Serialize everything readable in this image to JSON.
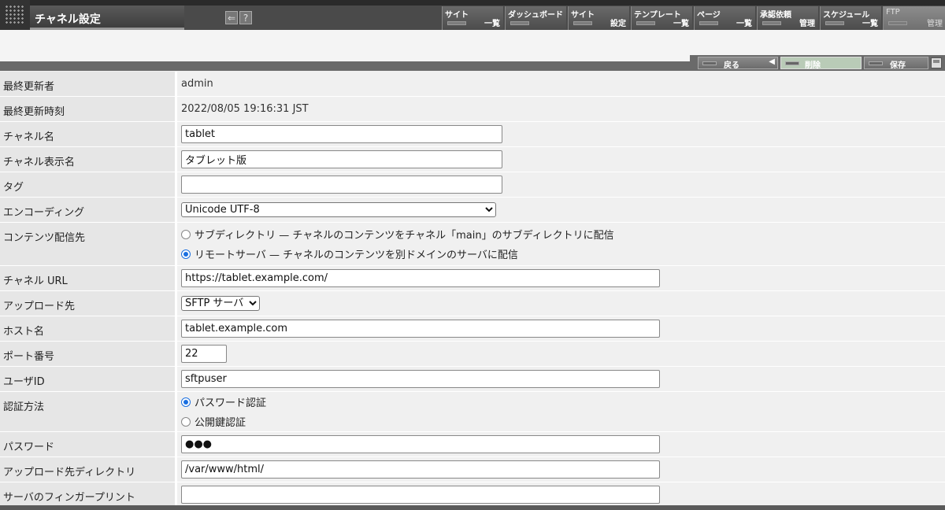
{
  "header": {
    "title": "チャネル設定",
    "tool_icons": [
      "back-arrow-icon",
      "help-icon"
    ],
    "help_glyph": "?",
    "nav": [
      {
        "top": "サイト",
        "bottom": "一覧"
      },
      {
        "top": "ダッシュボード",
        "bottom": ""
      },
      {
        "top": "サイト",
        "bottom": "設定"
      },
      {
        "top": "テンプレート",
        "bottom": "一覧"
      },
      {
        "top": "ページ",
        "bottom": "一覧"
      },
      {
        "top": "承認依頼",
        "bottom": "管理"
      },
      {
        "top": "スケジュール",
        "bottom": "一覧"
      },
      {
        "top": "FTP",
        "bottom": "管理"
      }
    ]
  },
  "actions": {
    "back_label": "戻る",
    "delete_label": "削除",
    "save_label": "保存"
  },
  "fields": {
    "last_updated_by_label": "最終更新者",
    "last_updated_by": "admin",
    "last_updated_at_label": "最終更新時刻",
    "last_updated_at": "2022/08/05 19:16:31 JST",
    "channel_name_label": "チャネル名",
    "channel_name": "tablet",
    "display_name_label": "チャネル表示名",
    "display_name": "タブレット版",
    "tag_label": "タグ",
    "tag": "",
    "encoding_label": "エンコーディング",
    "encoding": "Unicode UTF-8",
    "delivery_label": "コンテンツ配信先",
    "delivery_option_sub": "サブディレクトリ — チャネルのコンテンツをチャネル「main」のサブディレクトリに配信",
    "delivery_option_remote": "リモートサーバ — チャネルのコンテンツを別ドメインのサーバに配信",
    "delivery_selected": "remote",
    "url_label": "チャネル URL",
    "url": "https://tablet.example.com/",
    "upload_target_label": "アップロード先",
    "upload_target": "SFTP サーバ",
    "host_label": "ホスト名",
    "host": "tablet.example.com",
    "port_label": "ポート番号",
    "port": "22",
    "user_label": "ユーザID",
    "user": "sftpuser",
    "auth_label": "認証方法",
    "auth_option_password": "パスワード認証",
    "auth_option_key": "公開鍵認証",
    "auth_selected": "password",
    "password_label": "パスワード",
    "password": "●●●",
    "upload_dir_label": "アップロード先ディレクトリ",
    "upload_dir": "/var/www/html/",
    "fingerprint_label": "サーバのフィンガープリント",
    "fingerprint": ""
  }
}
